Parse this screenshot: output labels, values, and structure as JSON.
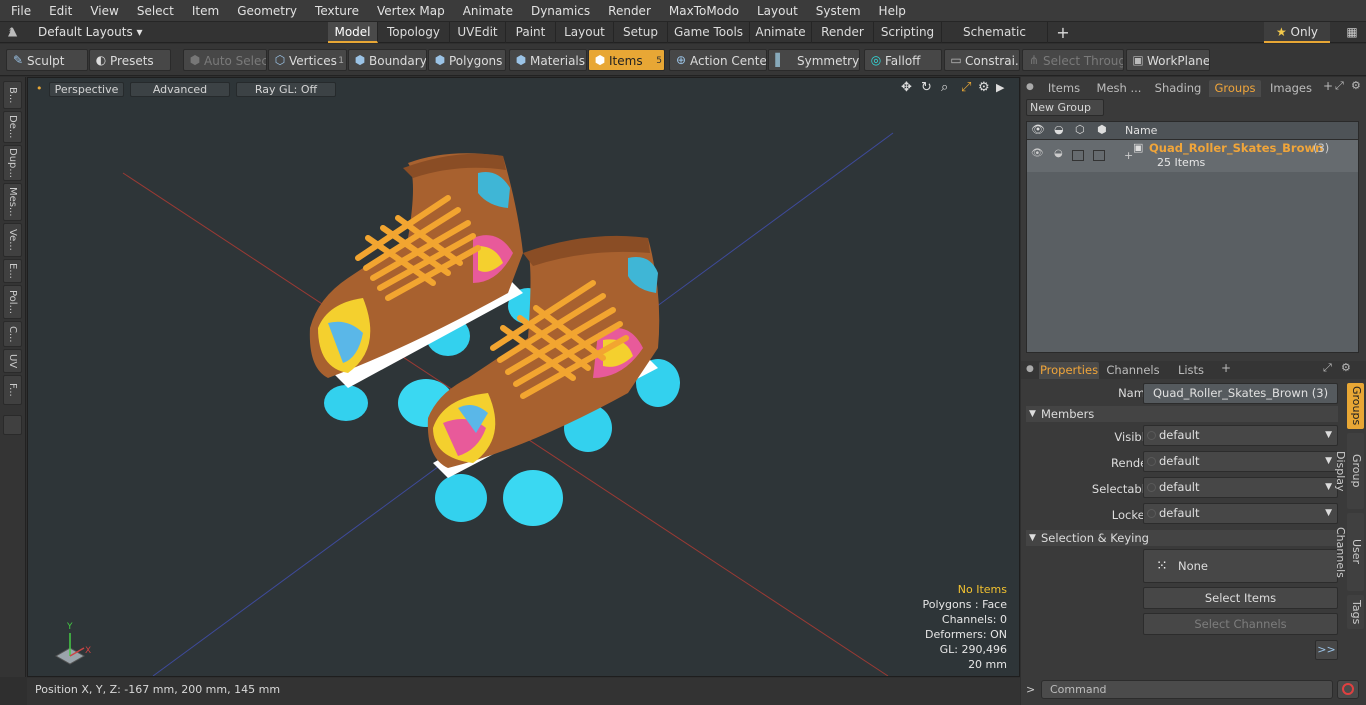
{
  "menu": [
    "File",
    "Edit",
    "View",
    "Select",
    "Item",
    "Geometry",
    "Texture",
    "Vertex Map",
    "Animate",
    "Dynamics",
    "Render",
    "MaxToModo",
    "Layout",
    "System",
    "Help"
  ],
  "layoutbar": {
    "layouts_label": "Default Layouts",
    "tabs": [
      "Model",
      "Topology",
      "UVEdit",
      "Paint",
      "Layout",
      "Setup",
      "Game Tools",
      "Animate",
      "Render",
      "Scripting",
      "Schematic Fusion"
    ],
    "only_label": "Only"
  },
  "toolbar": {
    "sculpt": "Sculpt",
    "presets": "Presets",
    "auto_select": "Auto Select",
    "vertices": "Vertices",
    "vertices_count": "1",
    "boundary": "Boundary",
    "polygons": "Polygons",
    "materials": "Materials",
    "items": "Items",
    "items_count": "5",
    "action_center": "Action Center",
    "symmetry": "Symmetry",
    "falloff": "Falloff",
    "constraints": "Constrai...",
    "select_through": "Select Through",
    "workplane": "WorkPlane"
  },
  "left_tabs": [
    "B...",
    "De...",
    "Dup...",
    "Mes...",
    "Ve...",
    "E...",
    "Pol...",
    "C...",
    "UV",
    "F..."
  ],
  "viewport": {
    "perspective": "Perspective",
    "advanced": "Advanced",
    "raygl": "Ray GL: Off",
    "info": {
      "no_items": "No Items",
      "polygons": "Polygons : Face",
      "channels": "Channels: 0",
      "deformers": "Deformers: ON",
      "gl": "GL: 290,496",
      "scale": "20 mm"
    },
    "axis_y": "Y",
    "axis_x": "X"
  },
  "statusbar": {
    "position": "Position X, Y, Z:   -167 mm, 200 mm, 145 mm"
  },
  "right_panel": {
    "top_tabs": [
      "Items",
      "Mesh ...",
      "Shading",
      "Groups",
      "Images"
    ],
    "new_group": "New Group",
    "list_header_name": "Name",
    "group_name": "Quad_Roller_Skates_Brown",
    "group_count": "(3)",
    "group_items": "25 Items",
    "prop_tabs": [
      "Properties",
      "Channels",
      "Lists"
    ],
    "name_label": "Name",
    "name_value": "Quad_Roller_Skates_Brown (3)",
    "members_header": "Members",
    "fields": [
      {
        "label": "Visible",
        "value": "default"
      },
      {
        "label": "Render",
        "value": "default"
      },
      {
        "label": "Selectable",
        "value": "default"
      },
      {
        "label": "Locked",
        "value": "default"
      }
    ],
    "selection_header": "Selection & Keying",
    "none_label": "None",
    "select_items": "Select Items",
    "select_channels": "Select Channels",
    "more": ">>",
    "side_tabs": [
      "Groups",
      "Group Display",
      "User Channels",
      "Tags"
    ],
    "command_placeholder": "Command"
  },
  "colors": {
    "accent": "#e8a735",
    "group_name": "#f0a53a",
    "viewport_bg": "#2e3538"
  }
}
